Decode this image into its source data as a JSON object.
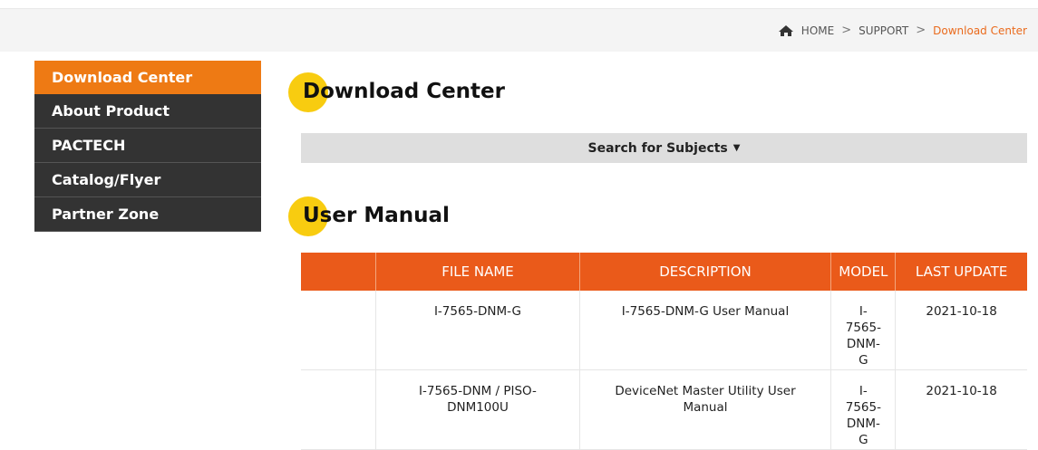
{
  "breadcrumb": {
    "items": [
      "HOME",
      "SUPPORT",
      "Download Center"
    ],
    "separator": ">"
  },
  "sidebar": {
    "items": [
      {
        "label": "Download Center",
        "active": true
      },
      {
        "label": "About Product",
        "active": false
      },
      {
        "label": "PACTECH",
        "active": false
      },
      {
        "label": "Catalog/Flyer",
        "active": false
      },
      {
        "label": "Partner Zone",
        "active": false
      }
    ]
  },
  "main": {
    "title": "Download Center",
    "search_label": "Search for Subjects",
    "section_title": "User Manual"
  },
  "table": {
    "columns": [
      "",
      "FILE NAME",
      "DESCRIPTION",
      "MODEL",
      "LAST UPDATE"
    ],
    "rows": [
      {
        "file": "I-7565-DNM-G",
        "description": "I-7565-DNM-G User Manual",
        "model": "I-7565-DNM-G",
        "updated": "2021-10-18"
      },
      {
        "file": "I-7565-DNM / PISO-DNM100U",
        "description": "DeviceNet Master Utility User Manual",
        "model": "I-7565-DNM-G",
        "updated": "2021-10-18"
      }
    ]
  },
  "colors": {
    "accent": "#ee7a14",
    "table_header": "#ea5a1a",
    "heading_dot": "#f8cc10",
    "sidebar_bg": "#333333"
  }
}
